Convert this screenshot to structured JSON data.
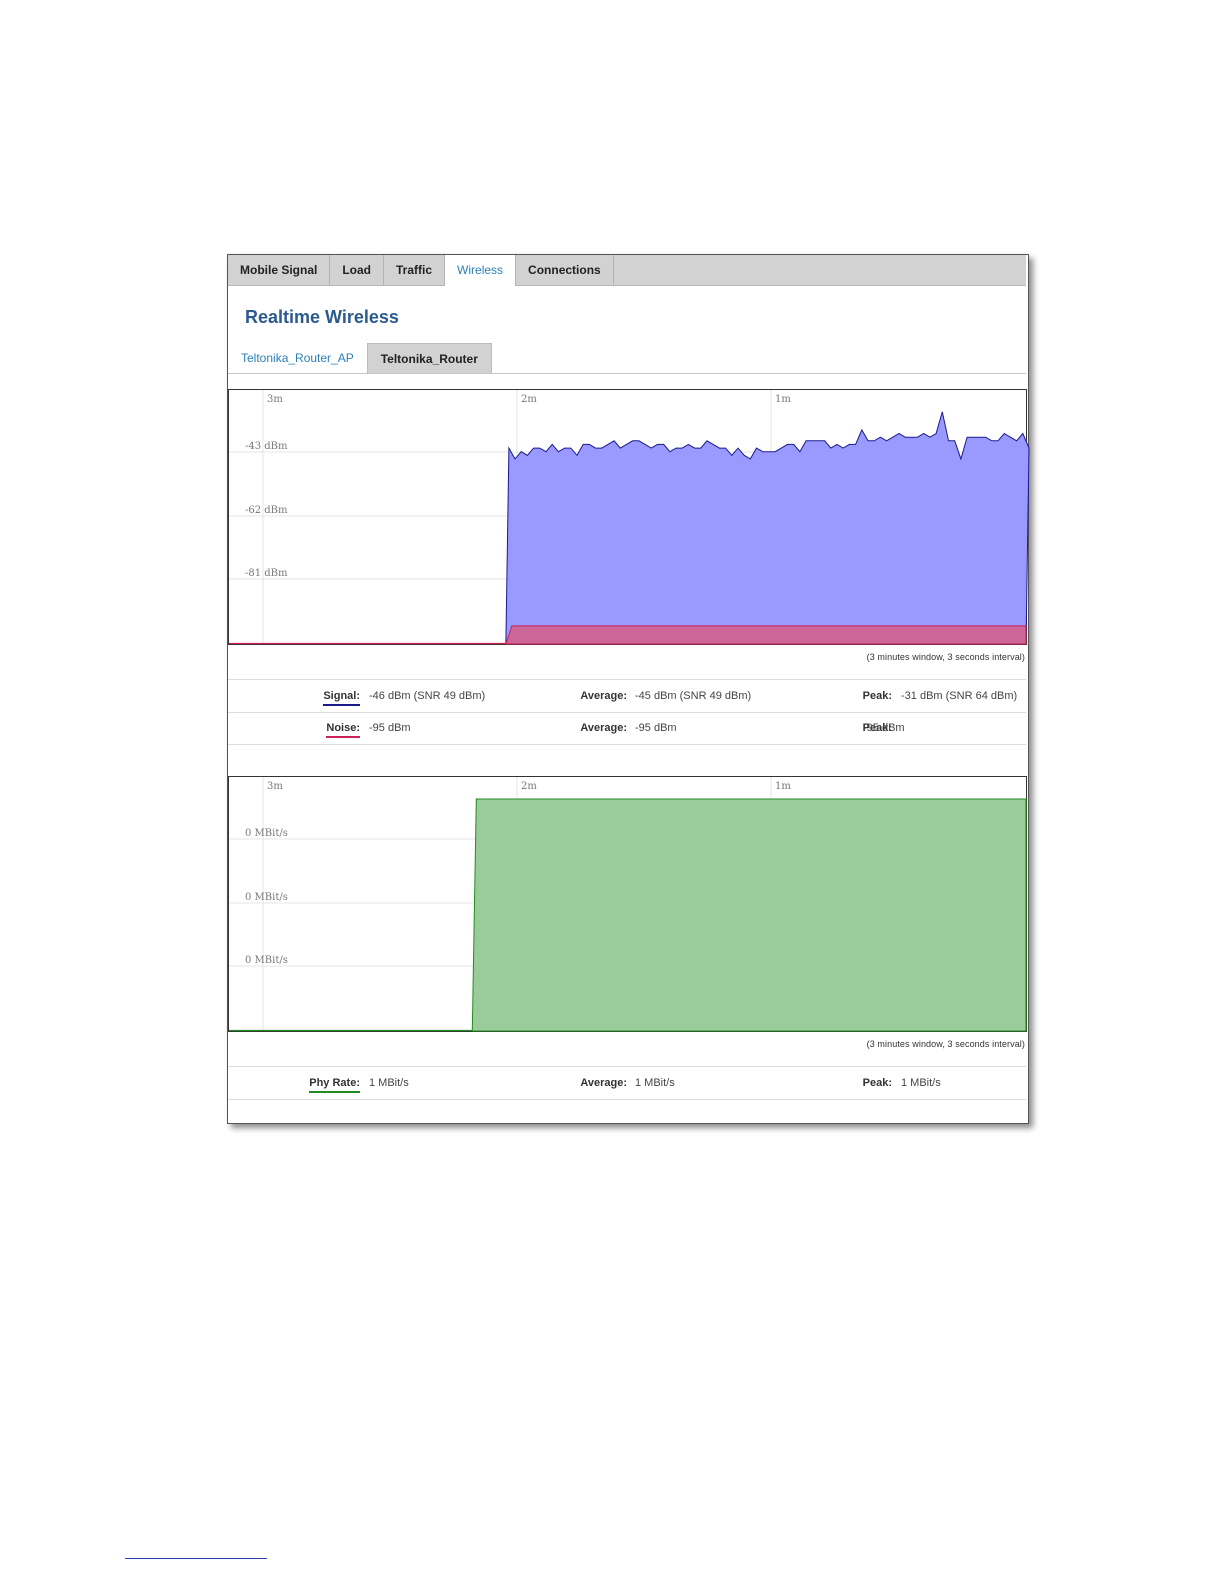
{
  "main_tabs": [
    {
      "label": "Mobile Signal",
      "active": false
    },
    {
      "label": "Load",
      "active": false
    },
    {
      "label": "Traffic",
      "active": false
    },
    {
      "label": "Wireless",
      "active": true
    },
    {
      "label": "Connections",
      "active": false
    }
  ],
  "page_title": "Realtime Wireless",
  "sub_tabs": [
    {
      "label": "Teltonika_Router_AP",
      "active": true
    },
    {
      "label": "Teltonika_Router",
      "active": false
    }
  ],
  "colors": {
    "signal_fill": "#9999ff",
    "signal_line": "#1a1a8c",
    "noise_fill": "#cc6699",
    "noise_line": "#cc2255",
    "phy_fill": "#99cc99",
    "phy_line": "#228b22",
    "active_tab": "#2c7fb8",
    "title": "#2b5a8f"
  },
  "chart_data": [
    {
      "type": "area",
      "x_ticks": [
        "3m",
        "2m",
        "1m"
      ],
      "y_ticks": [
        "-43 dBm",
        "-62 dBm",
        "-81 dBm"
      ],
      "y_tick_values": [
        -43,
        -62,
        -81
      ],
      "ylim": [
        -100,
        -30
      ],
      "xlim_seconds_ago": [
        190,
        0
      ],
      "grid": true,
      "caption": "(3 minutes window, 3 seconds interval)",
      "series": [
        {
          "name": "Signal",
          "start_seconds_ago": 124,
          "values": [
            -46,
            -49,
            -47,
            -48,
            -46,
            -46,
            -47,
            -45,
            -47,
            -46,
            -46,
            -48,
            -45,
            -45,
            -46,
            -46,
            -45,
            -44,
            -46,
            -45,
            -44,
            -44,
            -45,
            -46,
            -45,
            -45,
            -47,
            -46,
            -46,
            -45,
            -46,
            -46,
            -44,
            -45,
            -46,
            -46,
            -48,
            -46,
            -48,
            -49,
            -46,
            -47,
            -47,
            -47,
            -46,
            -45,
            -45,
            -47,
            -44,
            -44,
            -44,
            -44,
            -46,
            -45,
            -46,
            -45,
            -45,
            -41,
            -44,
            -44,
            -43,
            -44,
            -43,
            -42,
            -43,
            -43,
            -43,
            -42,
            -43,
            -42,
            -36,
            -44,
            -44,
            -49,
            -43,
            -43,
            -43,
            -43,
            -44,
            -44,
            -42,
            -43,
            -44,
            -42,
            -46
          ]
        },
        {
          "name": "Noise",
          "start_seconds_ago": 124,
          "values": [
            -95
          ]
        }
      ]
    },
    {
      "type": "area",
      "x_ticks": [
        "3m",
        "2m",
        "1m"
      ],
      "y_ticks": [
        "0 MBit/s",
        "0 MBit/s",
        "0 MBit/s"
      ],
      "xlim_seconds_ago": [
        190,
        0
      ],
      "grid": true,
      "caption": "(3 minutes window, 3 seconds interval)",
      "series": [
        {
          "name": "Phy Rate",
          "start_seconds_ago": 132,
          "values": [
            1
          ]
        }
      ]
    }
  ],
  "stats": {
    "signal": {
      "label": "Signal:",
      "current": "-46 dBm (SNR 49 dBm)",
      "avg_label": "Average:",
      "average": "-45 dBm (SNR 49 dBm)",
      "peak_label": "Peak:",
      "peak": "-31 dBm (SNR 64 dBm)"
    },
    "noise": {
      "label": "Noise:",
      "current": "-95 dBm",
      "avg_label": "Average:",
      "average": "-95 dBm",
      "peak_label": "Peak:",
      "peak": "-95 dBm"
    },
    "phy": {
      "label": "Phy Rate:",
      "current": "1 MBit/s",
      "avg_label": "Average:",
      "average": "1 MBit/s",
      "peak_label": "Peak:",
      "peak": "1 MBit/s"
    }
  }
}
